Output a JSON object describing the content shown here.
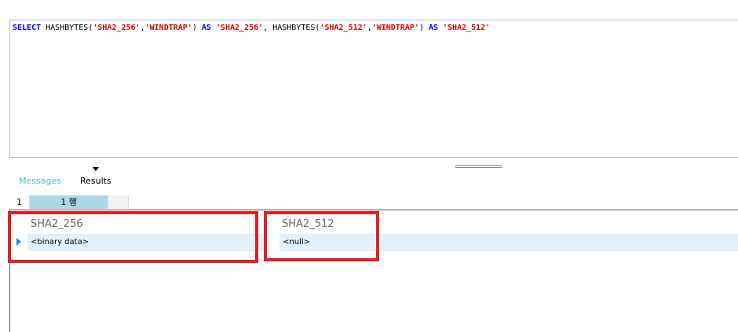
{
  "editor": {
    "tokens": [
      {
        "text": "SELECT",
        "cls": "kw"
      },
      {
        "text": " HASHBYTES(",
        "cls": "fn"
      },
      {
        "text": "'SHA2_256'",
        "cls": "str"
      },
      {
        "text": ",",
        "cls": "fn"
      },
      {
        "text": "'WINDTRAP'",
        "cls": "str"
      },
      {
        "text": ") ",
        "cls": "fn"
      },
      {
        "text": "AS",
        "cls": "kw"
      },
      {
        "text": " ",
        "cls": "fn"
      },
      {
        "text": "'SHA2_256'",
        "cls": "str"
      },
      {
        "text": ", HASHBYTES(",
        "cls": "fn"
      },
      {
        "text": "'SHA2_512'",
        "cls": "str"
      },
      {
        "text": ",",
        "cls": "fn"
      },
      {
        "text": "'WINDTRAP'",
        "cls": "str"
      },
      {
        "text": ") ",
        "cls": "fn"
      },
      {
        "text": "AS",
        "cls": "kw"
      },
      {
        "text": " ",
        "cls": "fn"
      },
      {
        "text": "'SHA2_512'",
        "cls": "str"
      }
    ]
  },
  "tabs": {
    "messages": "Messages",
    "results": "Results"
  },
  "result_tabs": {
    "number": "1",
    "active": "1 행"
  },
  "grid": {
    "columns": [
      "SHA2_256",
      "SHA2_512"
    ],
    "rows": [
      [
        "<binary data>",
        "<null>"
      ]
    ]
  },
  "colors": {
    "keyword": "#0000ff",
    "string": "#dd0000",
    "highlight": "#e01f26",
    "active_tab": "#acd8e6",
    "row_bg": "#e4f0fa"
  }
}
